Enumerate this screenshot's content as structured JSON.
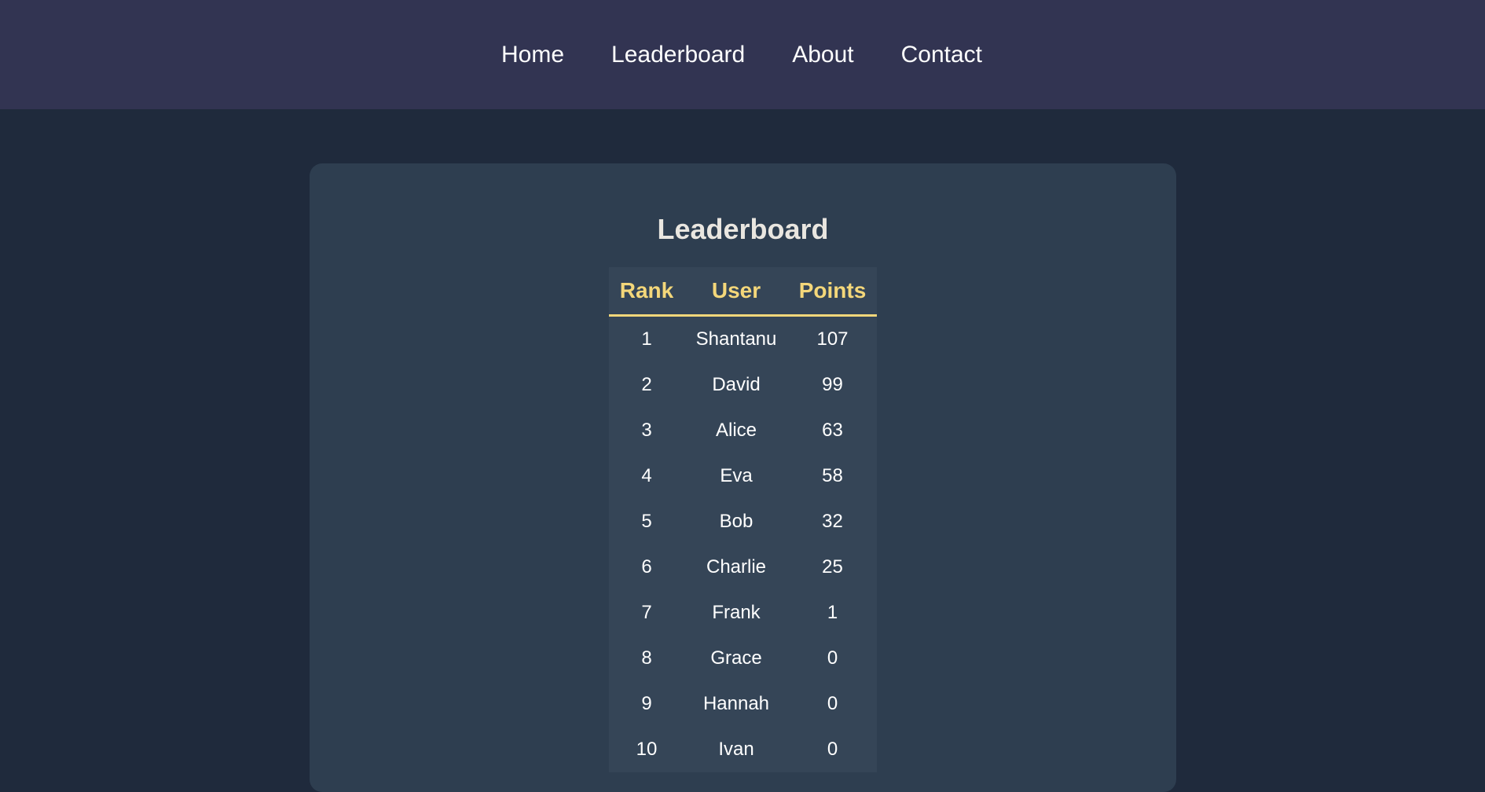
{
  "nav": {
    "items": [
      {
        "label": "Home"
      },
      {
        "label": "Leaderboard"
      },
      {
        "label": "About"
      },
      {
        "label": "Contact"
      }
    ]
  },
  "leaderboard": {
    "title": "Leaderboard",
    "columns": [
      "Rank",
      "User",
      "Points"
    ],
    "rows": [
      {
        "rank": "1",
        "user": "Shantanu",
        "points": "107"
      },
      {
        "rank": "2",
        "user": "David",
        "points": "99"
      },
      {
        "rank": "3",
        "user": "Alice",
        "points": "63"
      },
      {
        "rank": "4",
        "user": "Eva",
        "points": "58"
      },
      {
        "rank": "5",
        "user": "Bob",
        "points": "32"
      },
      {
        "rank": "6",
        "user": "Charlie",
        "points": "25"
      },
      {
        "rank": "7",
        "user": "Frank",
        "points": "1"
      },
      {
        "rank": "8",
        "user": "Grace",
        "points": "0"
      },
      {
        "rank": "9",
        "user": "Hannah",
        "points": "0"
      },
      {
        "rank": "10",
        "user": "Ivan",
        "points": "0"
      }
    ]
  },
  "colors": {
    "nav_background": "#323452",
    "page_background": "#1f2a3c",
    "card_background": "#2e3e50",
    "table_background": "#354557",
    "header_accent": "#f4d77a"
  }
}
